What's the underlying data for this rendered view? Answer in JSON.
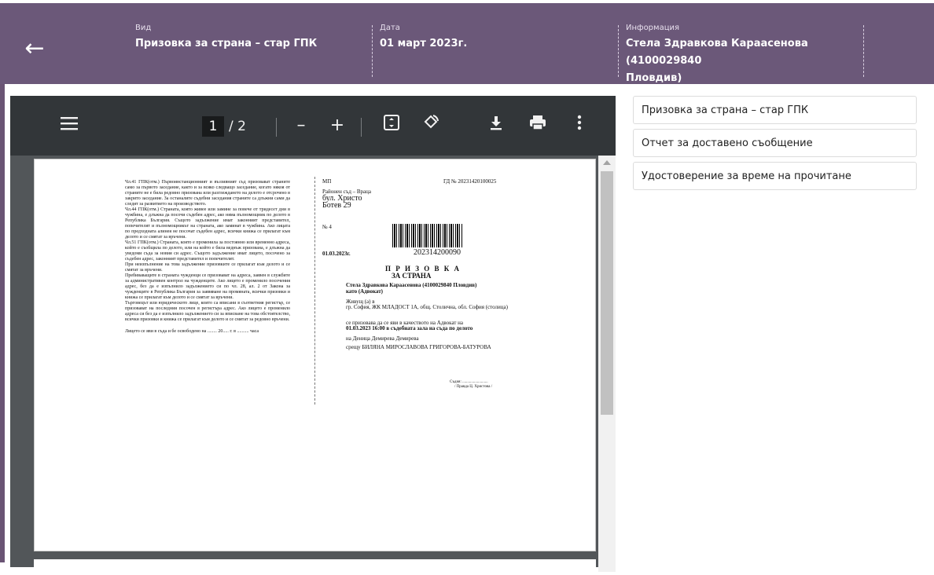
{
  "header": {
    "back_icon": "arrow-left-icon",
    "type_label": "Вид",
    "type_value": "Призовка за страна – стар ГПК",
    "date_label": "Дата",
    "date_value": "01 март 2023г.",
    "info_label": "Информация",
    "info_value_line1": "Стела Здравкова Карaасенова (4100029840",
    "info_value_line2": "Пловдив)"
  },
  "viewer": {
    "menu_icon": "hamburger-menu-icon",
    "current_page": "1",
    "total_pages": "/ 2",
    "zoom_out": "–",
    "zoom_in": "+",
    "fit_icon": "fit-page-icon",
    "rotate_icon": "rotate-icon",
    "download_icon": "download-icon",
    "print_icon": "print-icon",
    "more_icon": "more-vert-icon"
  },
  "document": {
    "left_paragraphs": [
      "Чл.41 ГПК(отм.) Първоинстанционният и въззивният съд призовават страните само за първото заседание, както и за всяко следващо заседание, когато някоя от страните не е била редовно призована или разглеждането на делото е отсрочено в закрито заседание. За останалите съдебни заседания страните са длъжни сами да следят за развитието на производството.",
      "Чл.44 ГПК(отм.) Страната, която живее или замине за повече от тридесет дни в чужбина, е длъжна да посочи съдебен адрес, ако няма пълномощник по делото в Република България. Същото задължение имат законният представител, попечителят и пълномощникът на страната, ако заминат в чужбина. Ако лицата по предходната алинея не посочат съдебен адрес, всички книжа се прилагат към делото и се смятат за връчени.",
      "Чл.51 ГПК(отм.) Страната, която е променила за постоянно или временно адреса, който е съобщила по делото, или на който е била веднъж призована, е длъжна да уведоми съда за новия си адрес. Същото задължение имат лицето, посочено за съдебен адрес, законният представител и попечителят.",
      "При неизпълнение на това задължение призовките се прилагат към делото и се смятат за връчени.",
      "Пребиваващите в страната чужденци се призовават на адреса, заявен в службите за административен контрол на чужденците. Ако лицето е променило посочения адрес, без да е изпълнило задължението си по чл. 28, ал. 2 от Закона за чужденците в Република България за заявяване на промяната, всички призовки и книжа се прилагат към делото и се смятат за връчени.",
      "Търговецът или юридическото лице, които са вписани в съответния регистър, се призовават на последния посочен в регистъра адрес. Ако лицето е променило адреса си без да е изпълнило задължението си за вписване на това обстоятелство, всички призовки и книжа се прилагат към делото и се смятат за редовно връчени."
    ],
    "left_footer": "Лицето се яви в съда и бе освободено на ........ 20..... г. в .......... часа",
    "mp": "МП",
    "case_no": "ГД № 20231420100025",
    "court_line1": "Районен съд – Враца",
    "court_line2": "бул. Христо",
    "court_line3": "Ботев 29",
    "number": "№ 4",
    "doc_date": "01.03.2023г.",
    "barcode_number": "202314200090",
    "title": "П Р И З О В К А",
    "subtitle": "ЗА СТРАНА",
    "addressee": "Стела Здравкова Караасенова (4100029840 Пловдив)",
    "role": "като (Адвокат)",
    "living": "Живущ (а) в",
    "address": "гр. София, ЖК МЛАДОСТ 1А, общ. Столична, обл. София (столица)",
    "summons_text": "се призовава да се яви в качеството на Адвокат на",
    "summons_time": "01.03.2023 16:00 в съдебната зала на съда по делото",
    "party1": "на Деница Демирева Демирева",
    "party2": "срещу БИЛЯНА МИРОСЛАВОВА ГРИГОРОВА-БАТУРОВА",
    "judge_label": "Съдия: ..........................",
    "judge_name": "/ Правда Ц. Христова /"
  },
  "sidebar": {
    "items": [
      "Призовка за страна – стар ГПК",
      "Отчет за доставено съобщение",
      "Удостоверение за време на прочитане"
    ]
  }
}
